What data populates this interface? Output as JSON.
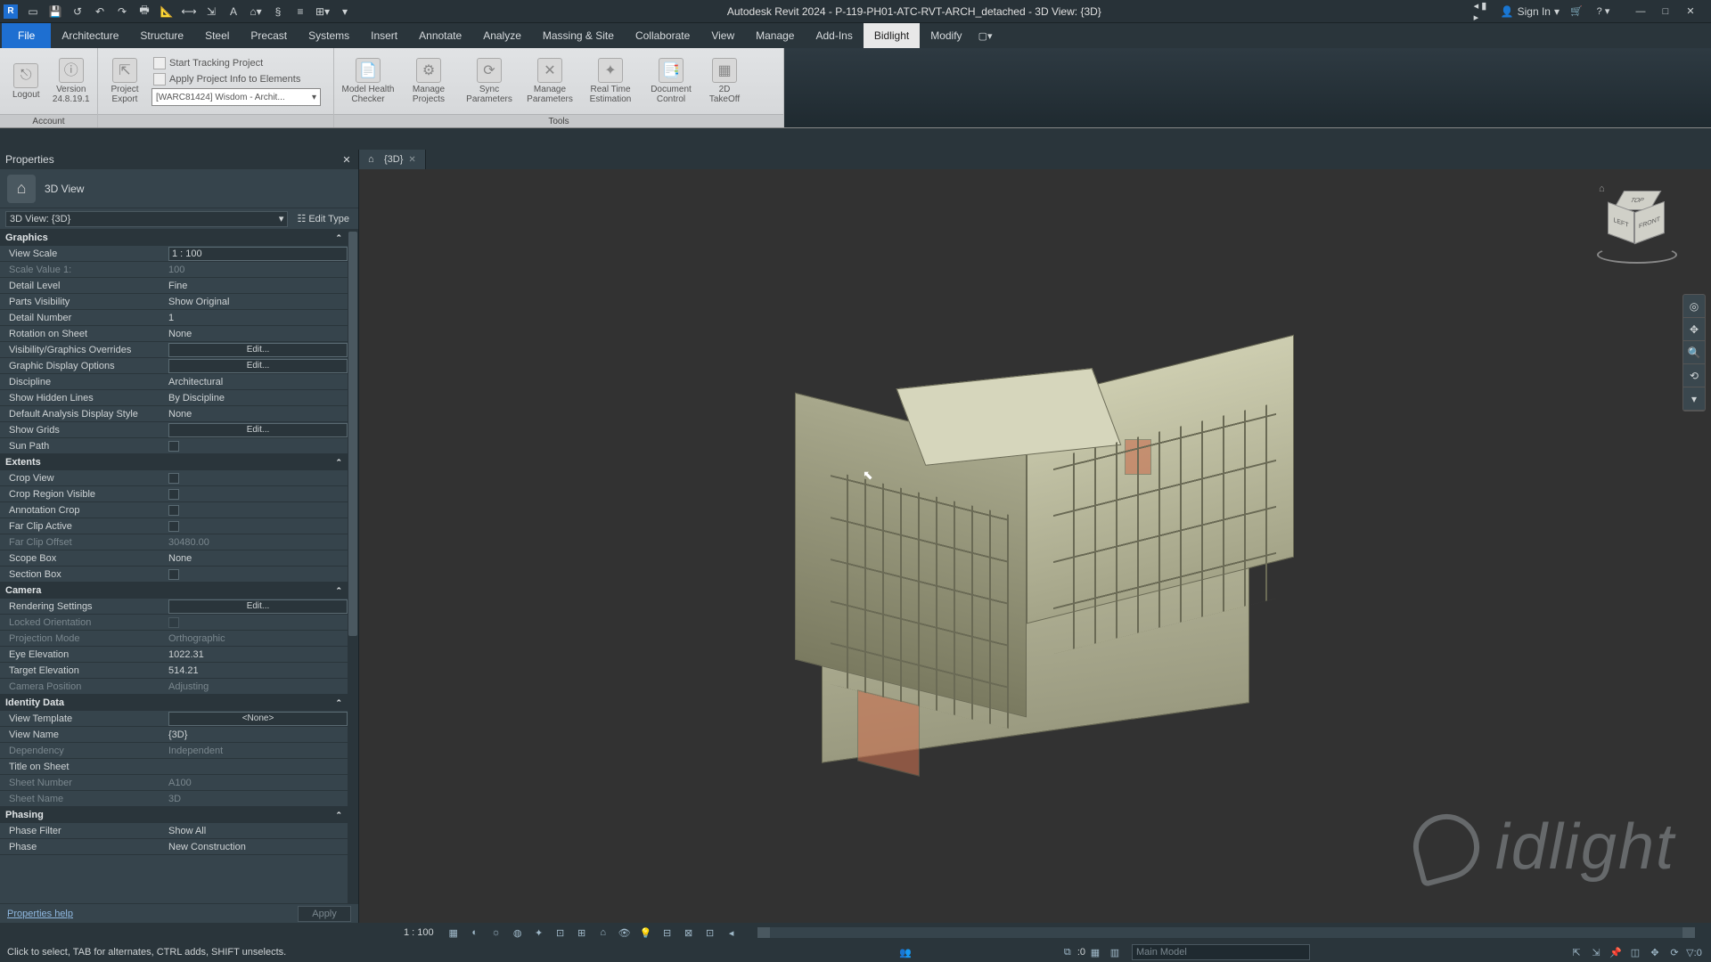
{
  "title": "Autodesk Revit 2024 - P-119-PH01-ATC-RVT-ARCH_detached - 3D View: {3D}",
  "signin": "Sign In",
  "ribbonTabs": [
    "Architecture",
    "Structure",
    "Steel",
    "Precast",
    "Systems",
    "Insert",
    "Annotate",
    "Analyze",
    "Massing & Site",
    "Collaborate",
    "View",
    "Manage",
    "Add-Ins",
    "Bidlight",
    "Modify"
  ],
  "activeTab": "Bidlight",
  "ribbon": {
    "account": {
      "label": "Account",
      "logout": "Logout",
      "version": "Version\n24.8.19.1",
      "export": "Project\nExport",
      "startTracking": "Start Tracking Project",
      "applyInfo": "Apply Project Info to Elements",
      "projectDropdown": "[WARC81424]  Wisdom - Archit..."
    },
    "tools": {
      "label": "Tools",
      "modelHealth": "Model Health\nChecker",
      "manageProjects": "Manage\nProjects",
      "syncParams": "Sync\nParameters",
      "manageParams": "Manage\nParameters",
      "realTime": "Real Time\nEstimation",
      "docControl": "Document\nControl",
      "takeoff": "2D\nTakeOff"
    }
  },
  "propertiesTitle": "Properties",
  "typeSelector": "3D View",
  "instanceDropdown": "3D View: {3D}",
  "editType": "Edit Type",
  "sections": {
    "graphics": "Graphics",
    "extents": "Extents",
    "camera": "Camera",
    "identity": "Identity Data",
    "phasing": "Phasing"
  },
  "props": {
    "viewScale": {
      "n": "View Scale",
      "v": "1 : 100",
      "input": true
    },
    "scaleValue": {
      "n": "Scale Value    1:",
      "v": "100",
      "dim": true
    },
    "detailLevel": {
      "n": "Detail Level",
      "v": "Fine"
    },
    "partsVis": {
      "n": "Parts Visibility",
      "v": "Show Original"
    },
    "detailNumber": {
      "n": "Detail Number",
      "v": "1"
    },
    "rotation": {
      "n": "Rotation on Sheet",
      "v": "None"
    },
    "vgOverrides": {
      "n": "Visibility/Graphics Overrides",
      "v": "Edit...",
      "btn": true
    },
    "gdo": {
      "n": "Graphic Display Options",
      "v": "Edit...",
      "btn": true
    },
    "discipline": {
      "n": "Discipline",
      "v": "Architectural"
    },
    "hiddenLines": {
      "n": "Show Hidden Lines",
      "v": "By Discipline"
    },
    "analysisStyle": {
      "n": "Default Analysis Display Style",
      "v": "None"
    },
    "showGrids": {
      "n": "Show Grids",
      "v": "Edit...",
      "btn": true
    },
    "sunPath": {
      "n": "Sun Path",
      "chk": true
    },
    "cropView": {
      "n": "Crop View",
      "chk": true
    },
    "cropRegion": {
      "n": "Crop Region Visible",
      "chk": true
    },
    "annotCrop": {
      "n": "Annotation Crop",
      "chk": true
    },
    "farClipActive": {
      "n": "Far Clip Active",
      "chk": true
    },
    "farClipOffset": {
      "n": "Far Clip Offset",
      "v": "30480.00",
      "dim": true
    },
    "scopeBox": {
      "n": "Scope Box",
      "v": "None"
    },
    "sectionBox": {
      "n": "Section Box",
      "chk": true
    },
    "rendering": {
      "n": "Rendering Settings",
      "v": "Edit...",
      "btn": true
    },
    "lockedOrient": {
      "n": "Locked Orientation",
      "chk": true,
      "dim": true
    },
    "projMode": {
      "n": "Projection Mode",
      "v": "Orthographic",
      "dim": true
    },
    "eyeElev": {
      "n": "Eye Elevation",
      "v": "1022.31"
    },
    "targetElev": {
      "n": "Target Elevation",
      "v": "514.21"
    },
    "camPos": {
      "n": "Camera Position",
      "v": "Adjusting",
      "dim": true
    },
    "viewTemplate": {
      "n": "View Template",
      "v": "<None>",
      "btn": true
    },
    "viewName": {
      "n": "View Name",
      "v": "{3D}"
    },
    "dependency": {
      "n": "Dependency",
      "v": "Independent",
      "dim": true
    },
    "titleOnSheet": {
      "n": "Title on Sheet",
      "v": ""
    },
    "sheetNumber": {
      "n": "Sheet Number",
      "v": "A100",
      "dim": true
    },
    "sheetName": {
      "n": "Sheet Name",
      "v": "3D",
      "dim": true
    },
    "phaseFilter": {
      "n": "Phase Filter",
      "v": "Show All"
    },
    "phase": {
      "n": "Phase",
      "v": "New Construction"
    }
  },
  "propertiesHelp": "Properties help",
  "apply": "Apply",
  "viewTab": "{3D}",
  "viewCtrlScale": "1 : 100",
  "statusHint": "Click to select, TAB for alternates, CTRL adds, SHIFT unselects.",
  "mainModel": "Main Model",
  "navCube": {
    "top": "TOP",
    "left": "LEFT",
    "front": "FRONT"
  },
  "selectionCount": ":0",
  "watermark": "idlight"
}
